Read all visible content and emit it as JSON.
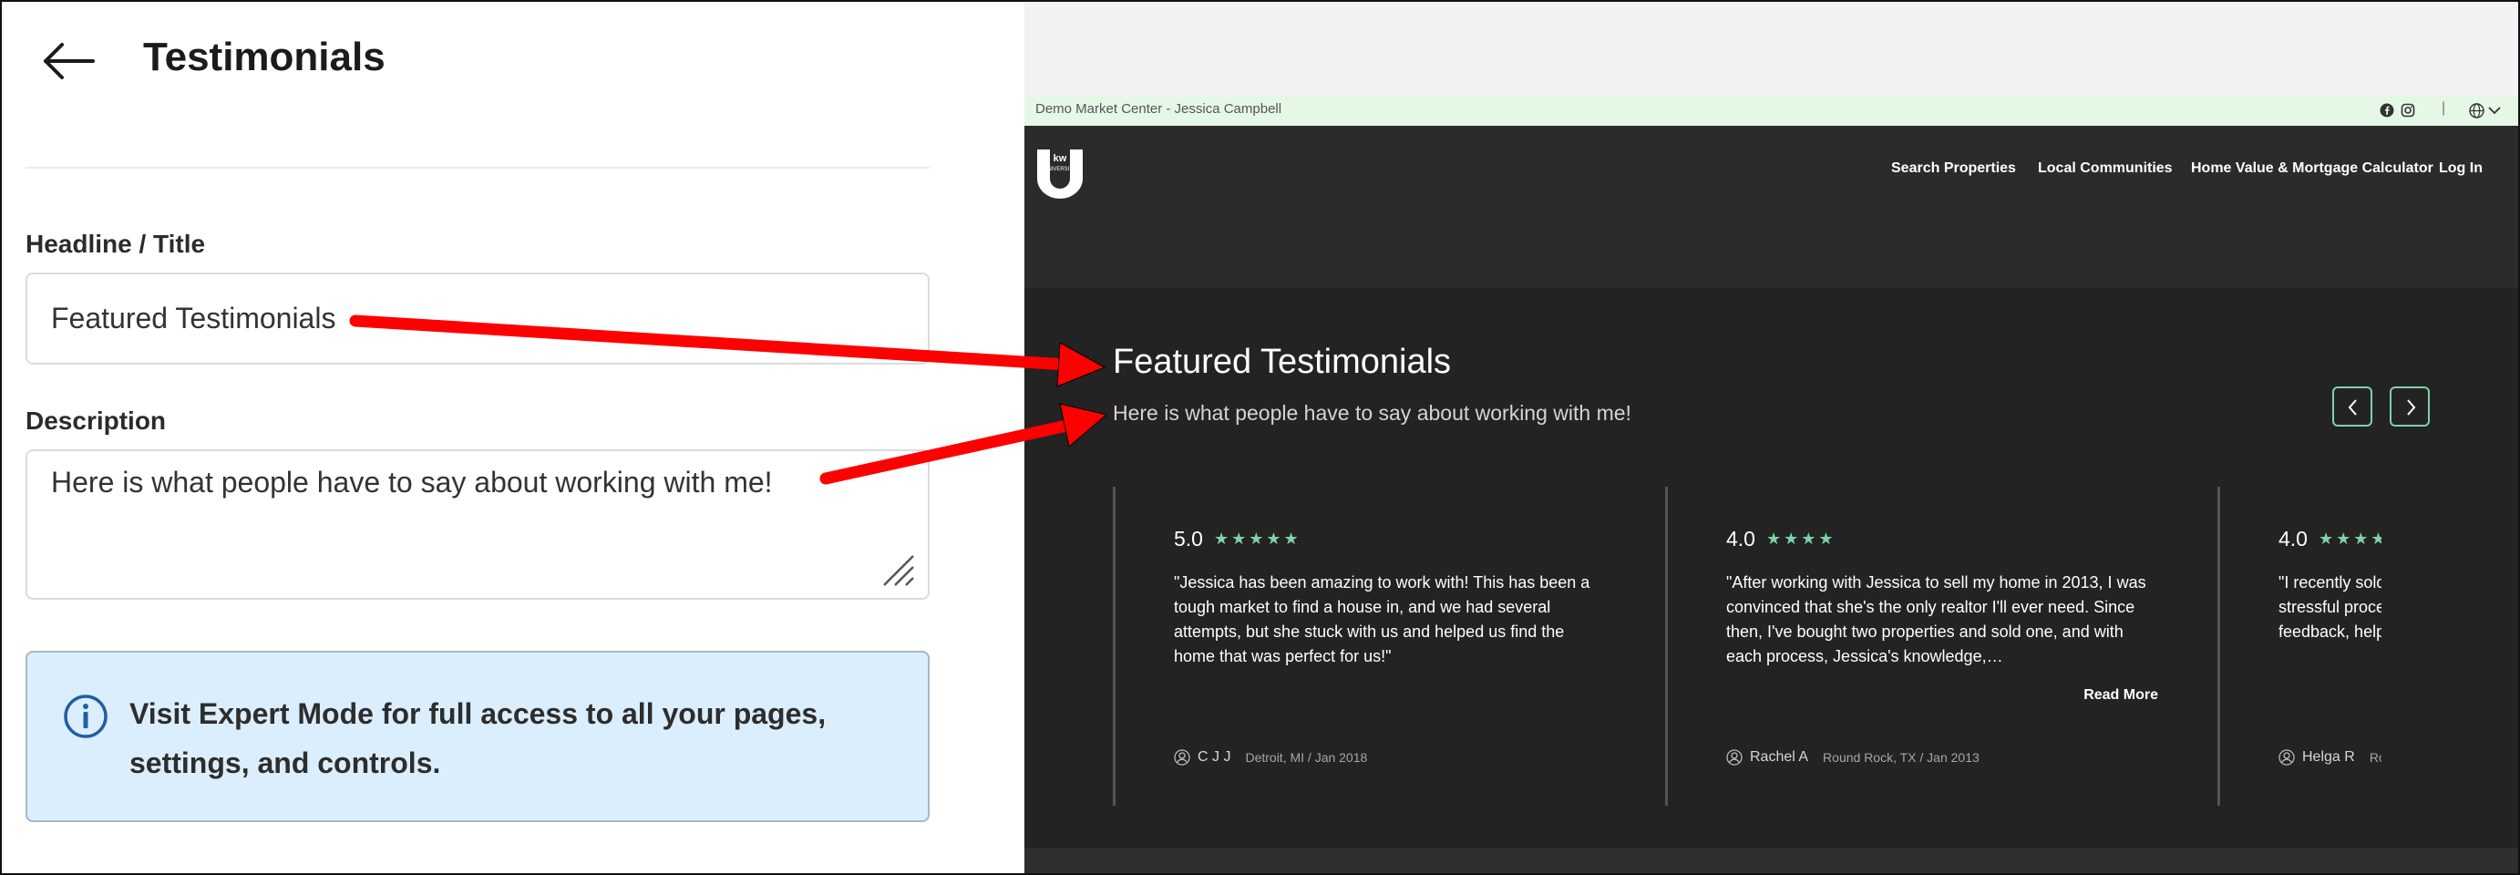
{
  "editor": {
    "title": "Testimonials",
    "headline_label": "Headline / Title",
    "headline_value": "Featured Testimonials",
    "description_label": "Description",
    "description_value": "Here is what people have to say about working with me!",
    "info_message": "Visit Expert Mode for full access to all your pages, settings, and controls."
  },
  "preview": {
    "topbar": {
      "market_text": "Demo Market Center - Jessica Campbell",
      "separator": "|"
    },
    "nav": [
      "Search Properties",
      "Local Communities",
      "Home Value & Mortgage Calculator",
      "Log In"
    ],
    "section": {
      "title": "Featured Testimonials",
      "description": "Here is what people have to say about working with me!",
      "prev_glyph": "‹",
      "next_glyph": "›"
    },
    "cards": [
      {
        "rating": "5.0",
        "stars": "★★★★★",
        "quote": "\"Jessica has been amazing to work with! This has been a tough market to find a house in, and we had several attempts, but she stuck with us and helped us find the home that was perfect for us!\"",
        "read_more": "",
        "name": "C J J",
        "meta": "Detroit, MI / Jan 2018"
      },
      {
        "rating": "4.0",
        "stars": "★★★★",
        "quote": "\"After working with Jessica to sell my home in 2013, I was convinced that she's the only realtor I'll ever need. Since then, I've bought two properties and sold one, and with each process, Jessica's knowledge,…",
        "read_more": "Read More",
        "name": "Rachel A",
        "meta": "Round Rock, TX / Jan 2013"
      },
      {
        "rating": "4.0",
        "stars": "★★★★",
        "quote": "\"I recently sold a house and it was going to be a very stressful process, but partnering with Jessica and her feedback, helped explain",
        "read_more": "",
        "name": "Helga R",
        "meta": "Round Rock"
      }
    ]
  },
  "colors": {
    "accent_green": "#7fd2a8",
    "annotation_red": "#ff0000",
    "info_bg": "#dbeefd",
    "preview_dark": "#232323"
  }
}
